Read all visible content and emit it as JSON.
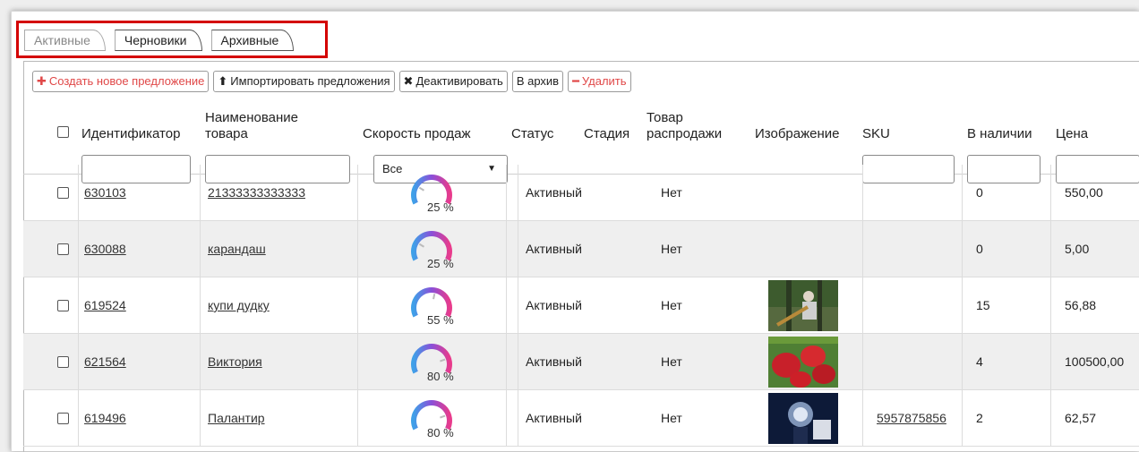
{
  "tabs": [
    {
      "label": "Активные",
      "active": true
    },
    {
      "label": "Черновики",
      "active": false
    },
    {
      "label": "Архивные",
      "active": false
    }
  ],
  "toolbar": {
    "create": "Создать новое предложение",
    "import": "Импортировать предложения",
    "deactivate": "Деактивировать",
    "archive": "В архив",
    "delete": "Удалить"
  },
  "columns": {
    "id": "Идентификатор",
    "name_line1": "Наименование",
    "name_line2": "товара",
    "speed": "Скорость продаж",
    "status": "Статус",
    "stage": "Стадия",
    "sale_line1": "Товар",
    "sale_line2": "распродажи",
    "image": "Изображение",
    "sku": "SKU",
    "stock": "В наличии",
    "price": "Цена"
  },
  "filters": {
    "speed_selected": "Все"
  },
  "rows": [
    {
      "id": "630103",
      "name": "21333333333333",
      "speed": "25 %",
      "speed_value": 25,
      "status": "Активный",
      "sale": "Нет",
      "image": "",
      "sku": "",
      "stock": "0",
      "price": "550,00"
    },
    {
      "id": "630088",
      "name": "карандаш",
      "speed": "25 %",
      "speed_value": 25,
      "status": "Активный",
      "sale": "Нет",
      "image": "",
      "sku": "",
      "stock": "0",
      "price": "5,00"
    },
    {
      "id": "619524",
      "name": "купи дудку",
      "speed": "55 %",
      "speed_value": 55,
      "status": "Активный",
      "sale": "Нет",
      "image": "person-with-horn-photo",
      "sku": "",
      "stock": "15",
      "price": "56,88"
    },
    {
      "id": "621564",
      "name": "Виктория",
      "speed": "80 %",
      "speed_value": 80,
      "status": "Активный",
      "sale": "Нет",
      "image": "strawberries-photo",
      "sku": "",
      "stock": "4",
      "price": "100500,00"
    },
    {
      "id": "619496",
      "name": "Палантир",
      "speed": "80 %",
      "speed_value": 80,
      "status": "Активный",
      "sale": "Нет",
      "image": "palantir-photo",
      "sku": "5957875856",
      "stock": "2",
      "price": "62,57"
    }
  ],
  "colors": {
    "highlight": "#d40000",
    "create_button": "#e04848",
    "gauge_blue": "#3fa0e8",
    "gauge_purple": "#8a4fd8",
    "gauge_pink": "#e83b8c"
  }
}
